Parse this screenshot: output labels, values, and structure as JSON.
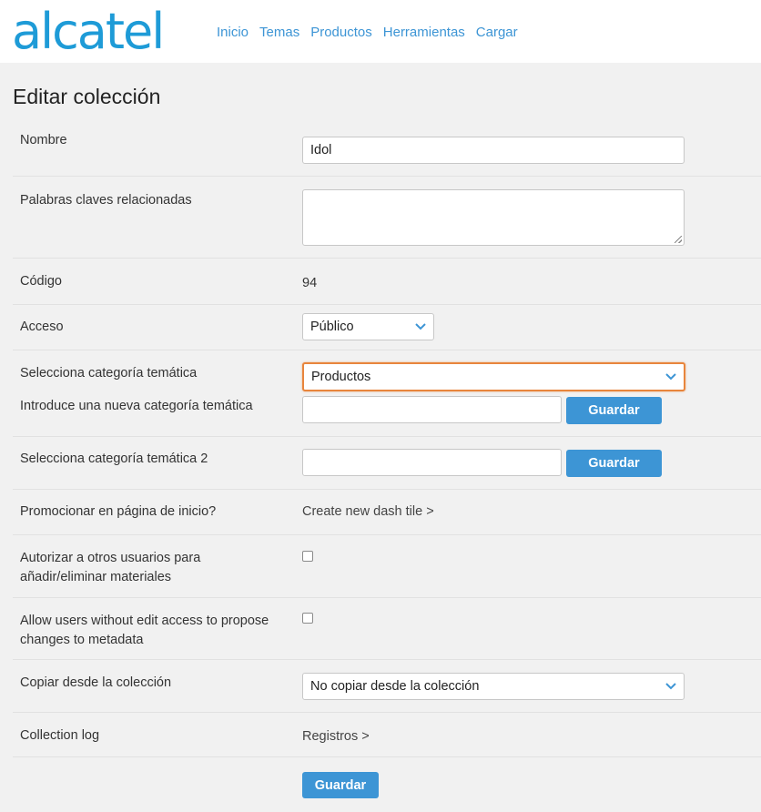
{
  "brand": {
    "logo_text": "alcatel",
    "color": "#1e9bd7"
  },
  "nav": {
    "items": [
      "Inicio",
      "Temas",
      "Productos",
      "Herramientas",
      "Cargar"
    ]
  },
  "page": {
    "title": "Editar colección"
  },
  "form": {
    "nombre": {
      "label": "Nombre",
      "value": "Idol"
    },
    "palabras": {
      "label": "Palabras claves relacionadas",
      "value": ""
    },
    "codigo": {
      "label": "Código",
      "value": "94"
    },
    "acceso": {
      "label": "Acceso",
      "selected": "Público"
    },
    "categoria": {
      "label": "Selecciona categoría temática",
      "selected": "Productos"
    },
    "nueva_categoria": {
      "label": "Introduce una nueva categoría temática",
      "value": "",
      "button": "Guardar"
    },
    "categoria2": {
      "label": "Selecciona categoría temática 2",
      "value": "",
      "button": "Guardar"
    },
    "promocionar": {
      "label": "Promocionar en página de inicio?",
      "link": "Create new dash tile >"
    },
    "autorizar": {
      "label_line1": "Autorizar a otros usuarios para",
      "label_line2": "añadir/eliminar materiales",
      "checked": false
    },
    "allow_users": {
      "label_line1": "Allow users without edit access to propose",
      "label_line2": "changes to metadata",
      "checked": false
    },
    "copiar": {
      "label": "Copiar desde la colección",
      "selected": "No copiar desde la colección"
    },
    "log": {
      "label": "Collection log",
      "link": "Registros >"
    },
    "submit": {
      "label": "Guardar"
    }
  },
  "colors": {
    "accent": "#3d95d5",
    "focus": "#e8853c",
    "nav_link": "#3d95d5"
  }
}
